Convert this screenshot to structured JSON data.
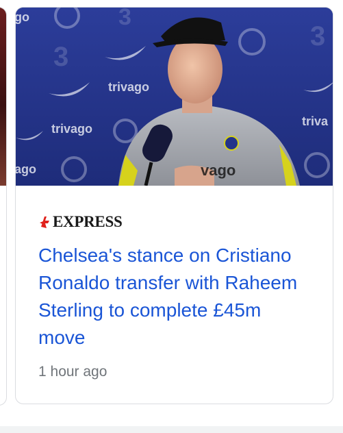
{
  "article": {
    "source": "EXPRESS",
    "headline": "Chelsea's stance on Cristiano Ronaldo transfer with Raheem Sterling to complete £45m move",
    "timestamp": "1 hour ago",
    "image": {
      "backdrop_color": "#23338a",
      "backdrop_sponsor_words": [
        "trivago",
        "trivago",
        "triva",
        "ago",
        "go",
        "vago"
      ]
    }
  },
  "colors": {
    "headline_link": "#1a55d6",
    "timestamp": "#70757a",
    "brand_express_red": "#e0211b"
  }
}
